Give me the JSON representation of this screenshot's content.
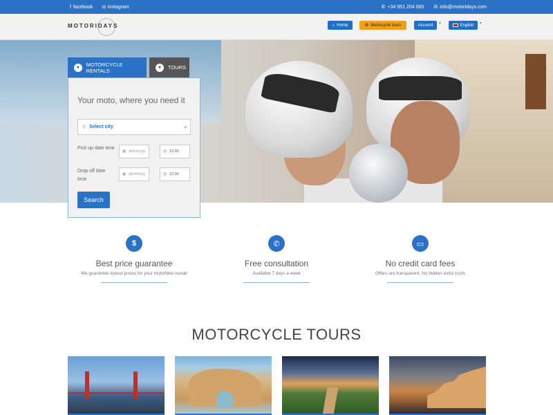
{
  "topbar": {
    "facebook": "facebook",
    "instagram": "Instagram",
    "phone": "+34 951 204 065",
    "email": "info@motoridays.com"
  },
  "nav": {
    "logo": "MOTORIDAYS",
    "home": "Home",
    "motorcycle_tours": "Motorcycle tours",
    "account": "Account",
    "language": "English"
  },
  "booking": {
    "tabs": [
      "MOTORCYCLE RENTALS",
      "TOURS"
    ],
    "heading": "Your moto, where you need it",
    "city_placeholder": "Select city",
    "pickup_label": "Pick up date time",
    "dropoff_label": "Drop off date time",
    "date_placeholder": "dd/mm/yy",
    "pickup_time": "12:30",
    "dropoff_time": "12:30",
    "search_label": "Search"
  },
  "features": [
    {
      "icon": "dollar-icon",
      "title": "Best price guarantee",
      "subtitle": "We guarantee lowest prices for your motorbike rental!"
    },
    {
      "icon": "phone-icon",
      "title": "Free consultation",
      "subtitle": "Available 7 days a week"
    },
    {
      "icon": "credit-card-icon",
      "title": "No credit card fees",
      "subtitle": "Offers are transparent. No hidden extra costs"
    }
  ],
  "tours": {
    "title": "MOTORCYCLE TOURS"
  },
  "colors": {
    "primary": "#2b72c6",
    "accent": "#f0a017"
  }
}
